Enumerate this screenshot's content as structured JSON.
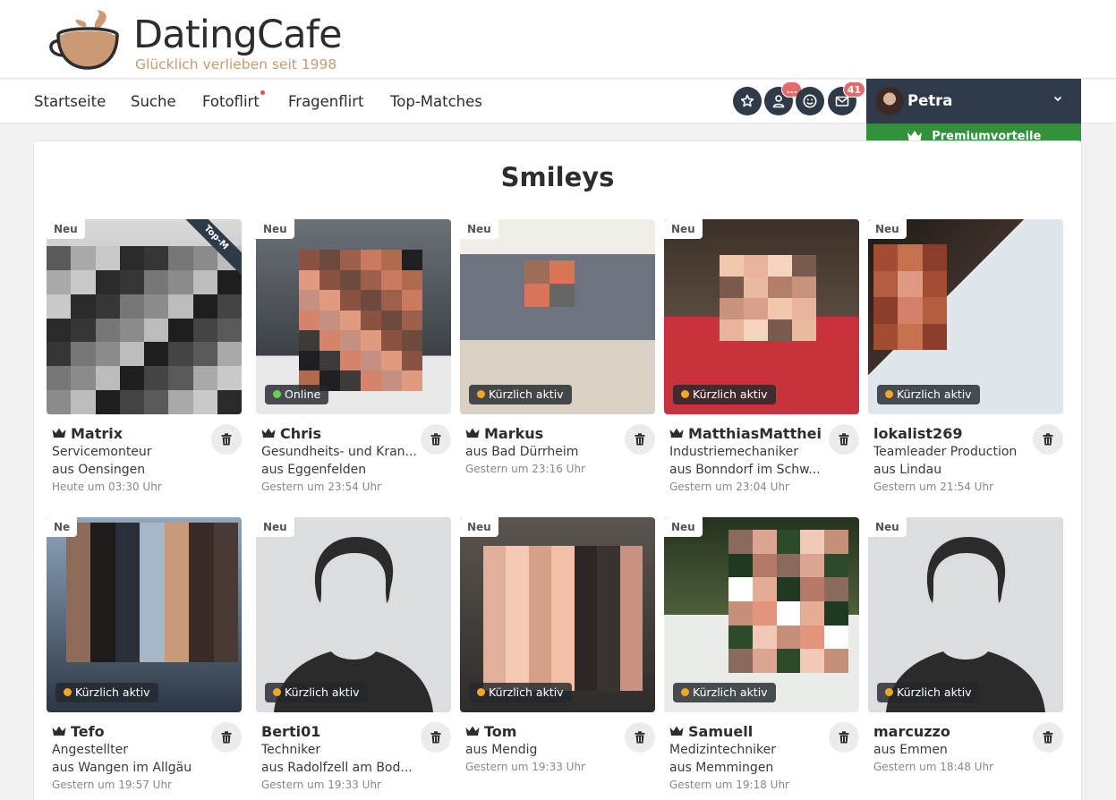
{
  "brand": {
    "title": "DatingCafe",
    "tagline": "Glücklich verlieben seit 1998"
  },
  "nav": [
    "Startseite",
    "Suche",
    "Fotoflirt",
    "Fragenflirt",
    "Top-Matches"
  ],
  "header_icons": [
    {
      "icon": "star-icon",
      "badge": ""
    },
    {
      "icon": "visitors-icon",
      "badge": "..."
    },
    {
      "icon": "smiley-icon",
      "badge": ""
    },
    {
      "icon": "mail-icon",
      "badge": "41"
    }
  ],
  "user": {
    "name": "Petra",
    "premium_label": "Premiumvorteile"
  },
  "page_title": "Smileys",
  "colors": {
    "primary": "#2e3a47",
    "premium": "#33913b",
    "badge": "#e46a6c",
    "online": "#6ecf4d",
    "recent": "#f5a623"
  },
  "cards": [
    {
      "name": "Matrix",
      "crown": true,
      "line1": "Servicemonteur",
      "line2": "aus Oensingen",
      "time": "Heute um 03:30 Uhr",
      "status": "",
      "new": "Neu",
      "top": "Top-M"
    },
    {
      "name": "Chris",
      "crown": true,
      "line1": "Gesundheits- und Kran...",
      "line2": "aus Eggenfelden",
      "time": "Gestern um 23:54 Uhr",
      "status": "Online",
      "new": "Neu",
      "top": ""
    },
    {
      "name": "Markus",
      "crown": true,
      "line1": "aus Bad Dürrheim",
      "line2": "",
      "time": "Gestern um 23:16 Uhr",
      "status": "Kürzlich aktiv",
      "new": "Neu",
      "top": ""
    },
    {
      "name": "MatthiasMatthei",
      "crown": true,
      "line1": "Industriemechaniker",
      "line2": "aus Bonndorf im Schw...",
      "time": "Gestern um 23:04 Uhr",
      "status": "Kürzlich aktiv",
      "new": "Neu",
      "top": ""
    },
    {
      "name": "lokalist269",
      "crown": false,
      "line1": "Teamleader Production",
      "line2": "aus Lindau",
      "time": "Gestern um 21:54 Uhr",
      "status": "Kürzlich aktiv",
      "new": "Neu",
      "top": ""
    },
    {
      "name": "Tefo",
      "crown": true,
      "line1": "Angestellter",
      "line2": "aus Wangen im Allgäu",
      "time": "Gestern um 19:57 Uhr",
      "status": "Kürzlich aktiv",
      "new": "Ne",
      "top": ""
    },
    {
      "name": "Berti01",
      "crown": false,
      "line1": "Techniker",
      "line2": "aus Radolfzell am Bod...",
      "time": "Gestern um 19:33 Uhr",
      "status": "Kürzlich aktiv",
      "new": "Neu",
      "top": ""
    },
    {
      "name": "Tom",
      "crown": true,
      "line1": "aus Mendig",
      "line2": "",
      "time": "Gestern um 19:33 Uhr",
      "status": "Kürzlich aktiv",
      "new": "Neu",
      "top": ""
    },
    {
      "name": "Samuell",
      "crown": true,
      "line1": "Medizintechniker",
      "line2": "aus Memmingen",
      "time": "Gestern um 19:18 Uhr",
      "status": "Kürzlich aktiv",
      "new": "Neu",
      "top": ""
    },
    {
      "name": "marcuzzo",
      "crown": false,
      "line1": "aus Emmen",
      "line2": "",
      "time": "Gestern um 18:48 Uhr",
      "status": "Kürzlich aktiv",
      "new": "Neu",
      "top": ""
    }
  ]
}
